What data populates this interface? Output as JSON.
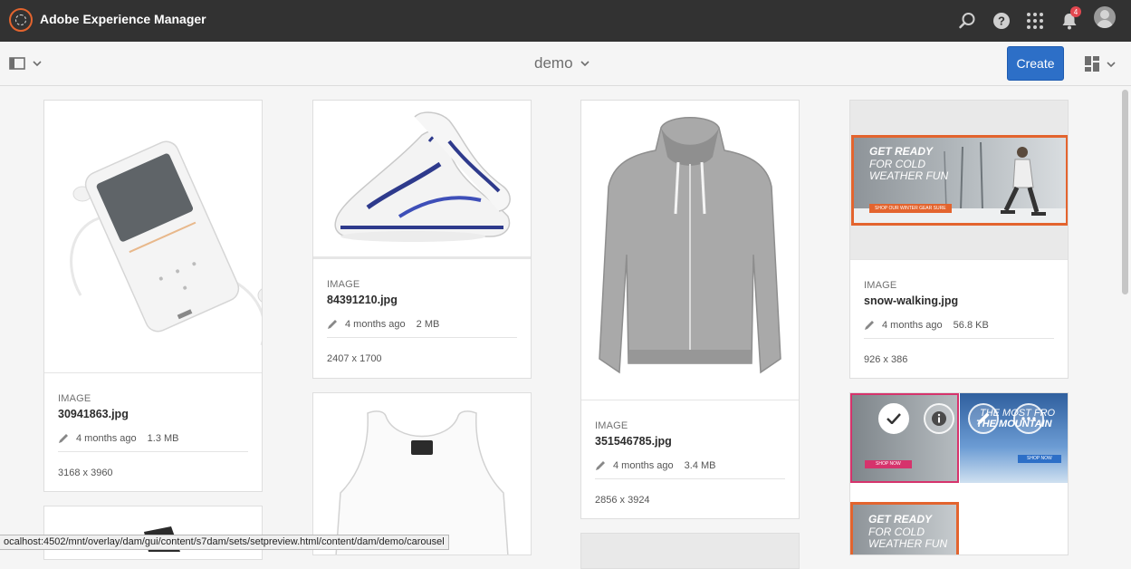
{
  "app": {
    "title": "Adobe Experience Manager",
    "notification_count": "4"
  },
  "actionbar": {
    "folder_title": "demo",
    "create_label": "Create"
  },
  "cards": [
    {
      "type": "IMAGE",
      "name": "30941863.jpg",
      "modified": "4 months ago",
      "size": "1.3 MB",
      "dimensions": "3168 x 3960"
    },
    {
      "type": "IMAGE",
      "name": "84391210.jpg",
      "modified": "4 months ago",
      "size": "2 MB",
      "dimensions": "2407 x 1700"
    },
    {
      "type": "IMAGE",
      "name": "351546785.jpg",
      "modified": "4 months ago",
      "size": "3.4 MB",
      "dimensions": "2856 x 3924"
    },
    {
      "type": "IMAGE",
      "name": "snow-walking.jpg",
      "modified": "4 months ago",
      "size": "56.8 KB",
      "dimensions": "926 x 386"
    }
  ],
  "banners": {
    "get_ready_1": "GET READY",
    "get_ready_2": "FOR COLD",
    "get_ready_3": "WEATHER FUN",
    "shop_gear": "SHOP OUR WINTER GEAR SURE",
    "shop_now": "SHOP NOW",
    "mountain_1": "THE MOST FRO",
    "mountain_2": "THE MOUNTAIN"
  },
  "status_url": "ocalhost:4502/mnt/overlay/dam/gui/content/s7dam/sets/setpreview.html/content/dam/demo/carousel",
  "colors": {
    "topbar": "#323232",
    "accent": "#2d6fc7",
    "brand": "#e3642e",
    "badge": "#e34850",
    "background": "#f5f5f5"
  },
  "icons": [
    "adobe-logo-icon",
    "search-icon",
    "help-icon",
    "apps-grid-icon",
    "bell-icon",
    "rail-toggle-icon",
    "chevron-down-icon",
    "card-view-icon",
    "pencil-icon",
    "checkmark-icon",
    "info-icon",
    "more-icon"
  ]
}
